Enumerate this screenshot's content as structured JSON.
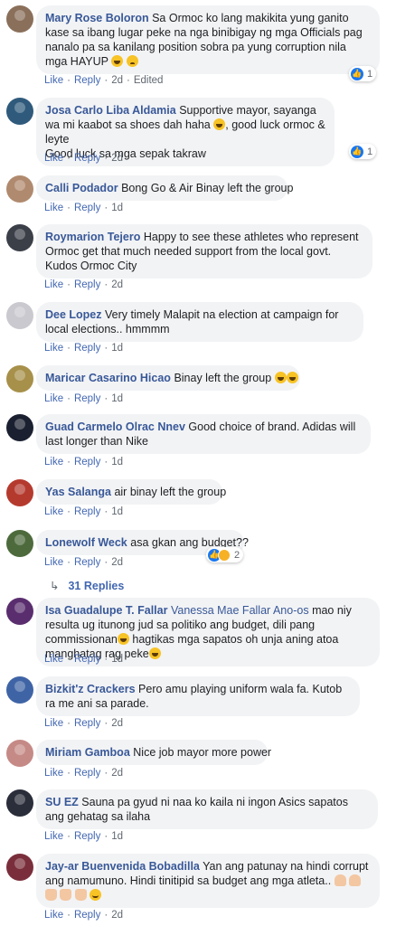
{
  "action_labels": {
    "like": "Like",
    "reply": "Reply",
    "edited": "Edited"
  },
  "comments": [
    {
      "author": "Mary Rose Boloron",
      "text": "Sa Ormoc ko lang makikita yung ganito kase sa ibang lugar peke na nga binibigay ng mga Officials pag nanalo pa sa kanilang position sobra pa yung corruption nila mga HAYUP",
      "emojis": [
        "laughing-crying-emoji",
        "worried-emoji"
      ],
      "time": "2d",
      "edited": true,
      "reactions": {
        "count": "1",
        "types": [
          "like-icon"
        ]
      },
      "avatar_color": "#8a6f5a"
    },
    {
      "author": "Josa Carlo Liba Aldamia",
      "text": "Supportive mayor, sayanga wa mi kaabot sa shoes dah haha",
      "text2": ", good luck ormoc & leyte",
      "text3": "Good luck sa mga sepak takraw",
      "time": "2d",
      "reactions": {
        "count": "1",
        "types": [
          "like-icon"
        ]
      },
      "avatar_color": "#2f5a7c"
    },
    {
      "author": "Calli Podador",
      "text": "Bong Go & Air Binay left the group",
      "time": "1d",
      "avatar_color": "#b08a6e"
    },
    {
      "author": "Roymarion Tejero",
      "text": "Happy to see these athletes who represent Ormoc get that much needed support from the local govt. Kudos Ormoc City",
      "time": "2d",
      "avatar_color": "#3b3f48"
    },
    {
      "author": "Dee Lopez",
      "text": "Very timely Malapit na election at campaign for local elections.. hmmmm",
      "time": "1d",
      "avatar_color": "#c9c9cf"
    },
    {
      "author": "Maricar Casarino Hicao",
      "text": "Binay left the group",
      "emojis": [
        "laughing-crying-emoji",
        "laughing-crying-emoji"
      ],
      "time": "1d",
      "avatar_color": "#a7904a"
    },
    {
      "author": "Guad Carmelo Olrac Nnev",
      "text": "Good choice of brand. Adidas will last longer than Nike",
      "time": "1d",
      "avatar_color": "#1a2030"
    },
    {
      "author": "Yas Salanga",
      "text": "air binay left the group",
      "time": "1d",
      "avatar_color": "#b53a2e"
    },
    {
      "author": "Lonewolf Weck",
      "text": "asa gkan ang budget??",
      "time": "2d",
      "reactions": {
        "count": "2",
        "types": [
          "like-icon",
          "haha-icon"
        ]
      },
      "replies": "31 Replies",
      "avatar_color": "#4d6a3c"
    },
    {
      "author": "Isa Guadalupe T. Fallar",
      "mention": "Vanessa Mae Fallar Ano-os",
      "text": "mao niy resulta ug itunong jud sa politiko ang budget, dili pang commissionan",
      "text2": "hagtikas mga sapatos oh unja aning atoa manghatag rag peke",
      "time": "1d",
      "avatar_color": "#5a2e6e"
    },
    {
      "author": "Bizkit'z Crackers",
      "text": "Pero amu playing uniform wala fa. Kutob ra me ani sa parade.",
      "time": "2d",
      "avatar_color": "#3f64a6"
    },
    {
      "author": "Miriam Gamboa",
      "text": "Nice job mayor more power",
      "time": "2d",
      "avatar_color": "#c58a86"
    },
    {
      "author": "SU EZ",
      "text": "Sauna pa gyud ni naa ko kaila ni ingon Asics sapatos ang gehatag sa ilaha",
      "time": "1d",
      "avatar_color": "#2a2d3a"
    },
    {
      "author": "Jay-ar Buenvenida Bobadilla",
      "text": "Yan ang patunay na hindi corrupt ang namumuno. Hindi tinitipid sa budget ang mga atleta..",
      "emojis": [
        "raised-hand-emoji",
        "clapping-emoji",
        "thumbs-up-emoji",
        "thumbs-up-emoji",
        "thumbs-up-emoji",
        "smiling-emoji"
      ],
      "time": "2d",
      "avatar_color": "#7a2e3b"
    }
  ]
}
